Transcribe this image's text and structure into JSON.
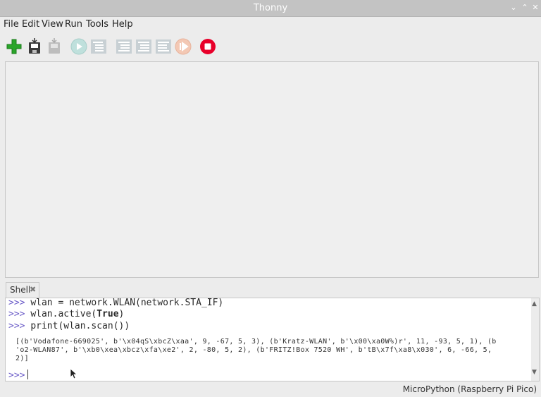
{
  "window": {
    "title": "Thonny"
  },
  "menubar": {
    "items": [
      "File",
      "Edit",
      "View",
      "Run",
      "Tools",
      "Help"
    ]
  },
  "toolbar": {
    "buttons": [
      "new-file",
      "save-file",
      "save-file-disabled",
      "run",
      "debug",
      "step-over",
      "step-into",
      "step-out",
      "resume",
      "stop"
    ]
  },
  "shell": {
    "tab_label": "Shell",
    "prompt": ">>>",
    "lines": [
      {
        "prefix": "wlan = network.WLAN(network.STA_IF)",
        "keyword": "",
        "suffix": ""
      },
      {
        "prefix": "wlan.active(",
        "keyword": "True",
        "suffix": ")"
      },
      {
        "prefix": "print(wlan.scan())",
        "keyword": "",
        "suffix": ""
      }
    ],
    "output": [
      "[(b'Vodafone-669025', b'\\x04qS\\xbcZ\\xaa', 9, -67, 5, 3), (b'Kratz-WLAN', b'\\x00\\xa0W%)r', 11, -93, 5, 1), (b",
      "'o2-WLAN87', b'\\xb0\\xea\\xbcz\\xfa\\xe2', 2, -80, 5, 2), (b'FRITZ!Box 7520 WH', b'tB\\x7f\\xa8\\x030', 6, -66, 5,",
      "2)]"
    ]
  },
  "statusbar": {
    "text": "MicroPython (Raspberry Pi Pico)"
  },
  "colors": {
    "stop": "#e8002a",
    "add": "#2aa52a",
    "prompt": "#6b5cc8",
    "disabled": "#c8d0d4"
  }
}
